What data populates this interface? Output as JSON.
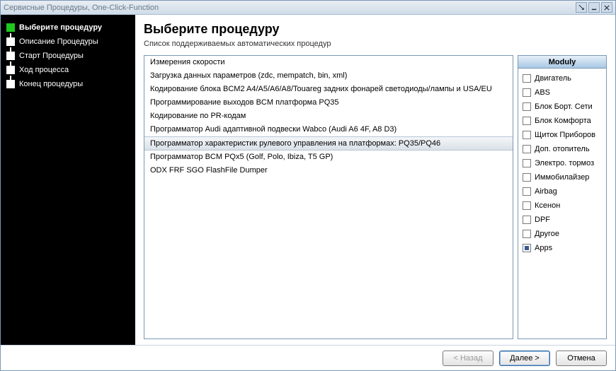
{
  "window": {
    "title": "Сервисные Процедуры, One-Click-Function"
  },
  "sidebar": {
    "steps": [
      {
        "label": "Выберите процедуру",
        "active": true
      },
      {
        "label": "Описание Процедуры",
        "active": false
      },
      {
        "label": "Старт Процедуры",
        "active": false
      },
      {
        "label": "Ход процесса",
        "active": false
      },
      {
        "label": "Конец процедуры",
        "active": false
      }
    ]
  },
  "main": {
    "title": "Выберите процедуру",
    "subtitle": "Список поддерживаемых автоматических процедур",
    "procedures": [
      "Измерения скорости",
      "Загрузка данных параметров (zdc, mempatch, bin, xml)",
      "Кодирование блока  BCM2 A4/A5/A6/A8/Touareg  задних фонарей светодиоды/лампы и  USA/EU",
      "Программирование выходов BCM платформа PQ35",
      "Кодирование по PR-кодам",
      "Программатор Audi адаптивной подвески Wabco (Audi A6 4F, A8 D3)",
      "Программатор характеристик рулевого управления на платформах: PQ35/PQ46",
      "Программатор BCM PQx5 (Golf, Polo, Ibiza, T5 GP)",
      "ODX FRF SGO FlashFile Dumper"
    ],
    "selected_index": 6
  },
  "modules": {
    "header": "Moduly",
    "items": [
      {
        "label": "Двигатель",
        "checked": false
      },
      {
        "label": "ABS",
        "checked": false
      },
      {
        "label": "Блок Борт. Сети",
        "checked": false
      },
      {
        "label": "Блок Комфорта",
        "checked": false
      },
      {
        "label": "Щиток Приборов",
        "checked": false
      },
      {
        "label": "Доп. отопитель",
        "checked": false
      },
      {
        "label": "Электро. тормоз",
        "checked": false
      },
      {
        "label": "Иммобилайзер",
        "checked": false
      },
      {
        "label": "Airbag",
        "checked": false
      },
      {
        "label": "Ксенон",
        "checked": false
      },
      {
        "label": "DPF",
        "checked": false
      },
      {
        "label": "Другое",
        "checked": false
      },
      {
        "label": "Apps",
        "checked": true
      }
    ]
  },
  "footer": {
    "back": "< Назад",
    "next": "Далее >",
    "cancel": "Отмена"
  }
}
